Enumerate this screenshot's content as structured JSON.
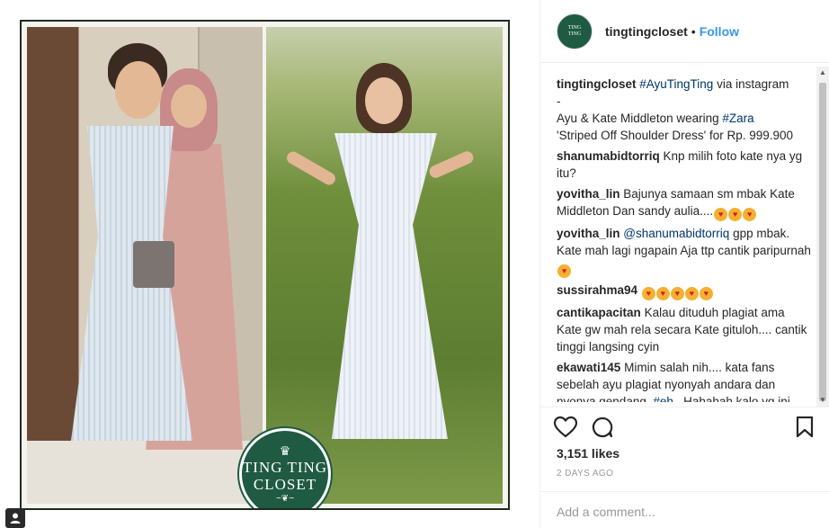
{
  "post": {
    "username": "tingtingcloset",
    "separator": "•",
    "follow_label": "Follow",
    "logo_text": [
      "TING TING",
      "CLOSET"
    ],
    "likes": "3,151 likes",
    "timestamp": "2 DAYS AGO",
    "add_comment_placeholder": "Add a comment..."
  },
  "caption": {
    "user": "tingtingcloset",
    "tag1": "#AyuTingTing",
    "text1": " via instagram",
    "text2": "-",
    "text3": "Ayu & Kate Middleton wearing ",
    "tag2": "#Zara",
    "text4": "'Striped Off Shoulder Dress' for Rp. 999.900"
  },
  "comments": [
    {
      "user": "shanumabidtorriq",
      "text": "Knp milih foto kate nya yg itu?",
      "emoji_count": 0
    },
    {
      "user": "yovitha_lin",
      "text": "Bajunya samaan sm mbak Kate Middleton Dan sandy aulia....",
      "emoji_count": 3
    },
    {
      "user": "yovitha_lin",
      "mention": "@shanumabidtorriq",
      "text": "gpp mbak. Kate mah lagi ngapain Aja ttp cantik paripurnah",
      "emoji_count": 1
    },
    {
      "user": "sussirahma94",
      "text": "",
      "emoji_count": 5
    },
    {
      "user": "cantikapacitan",
      "text": "Kalau dituduh plagiat ama Kate gw mah rela secara Kate gituloh.... cantik tinggi langsing cyin",
      "emoji_count": 0
    },
    {
      "user": "ekawati145",
      "text": "Mimin salah nih.... kata fans sebelah ayu plagiat nyonyah andara dan nyonya gendang. ",
      "tag": "#eh",
      "text_after": " . Hahahah kalo yg ini",
      "emoji_count": 0
    }
  ],
  "icons": {
    "like": "heart-icon",
    "comment": "comment-icon",
    "save": "bookmark-icon",
    "emoji": "heart-eyes-emoji"
  },
  "colors": {
    "link_blue": "#3897f0",
    "tag_blue": "#003569",
    "brand_green": "#1f5a43",
    "muted_gray": "#999999"
  }
}
